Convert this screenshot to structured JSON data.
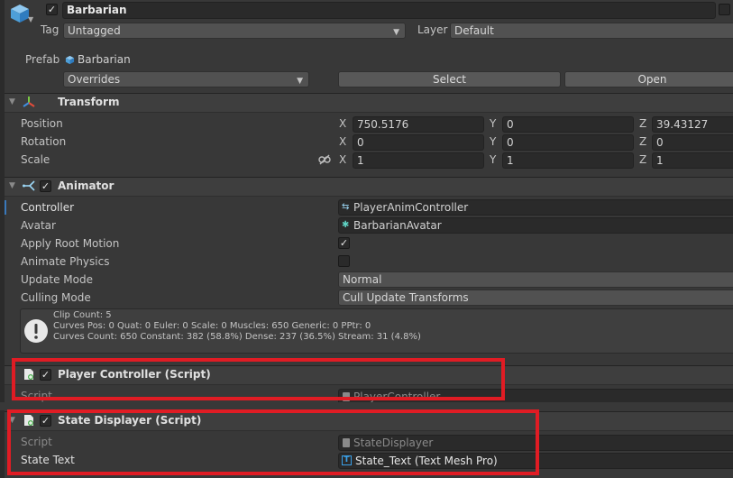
{
  "gameobject": {
    "name": "Barbarian",
    "tag_label": "Tag",
    "tag_value": "Untagged",
    "layer_label": "Layer",
    "layer_value": "Default",
    "prefab_label": "Prefab",
    "prefab_value": "Barbarian",
    "overrides_label": "Overrides",
    "select_label": "Select",
    "open_label": "Open"
  },
  "transform": {
    "title": "Transform",
    "position_label": "Position",
    "rotation_label": "Rotation",
    "scale_label": "Scale",
    "axis_x": "X",
    "axis_y": "Y",
    "axis_z": "Z",
    "position": {
      "x": "750.5176",
      "y": "0",
      "z": "39.43127"
    },
    "rotation": {
      "x": "0",
      "y": "0",
      "z": "0"
    },
    "scale": {
      "x": "1",
      "y": "1",
      "z": "1"
    }
  },
  "animator": {
    "title": "Animator",
    "controller_label": "Controller",
    "controller_value": "PlayerAnimController",
    "avatar_label": "Avatar",
    "avatar_value": "BarbarianAvatar",
    "apply_root_motion_label": "Apply Root Motion",
    "apply_root_motion": true,
    "animate_physics_label": "Animate Physics",
    "animate_physics": false,
    "update_mode_label": "Update Mode",
    "update_mode_value": "Normal",
    "culling_mode_label": "Culling Mode",
    "culling_mode_value": "Cull Update Transforms",
    "info_line1": "Clip Count: 5",
    "info_line2": "Curves Pos: 0 Quat: 0 Euler: 0 Scale: 0 Muscles: 650 Generic: 0 PPtr: 0",
    "info_line3": "Curves Count: 650 Constant: 382 (58.8%) Dense: 237 (36.5%) Stream: 31 (4.8%)"
  },
  "player_controller": {
    "title": "Player Controller (Script)",
    "script_label": "Script",
    "script_value": "PlayerController"
  },
  "state_displayer": {
    "title": "State Displayer (Script)",
    "script_label": "Script",
    "script_value": "StateDisplayer",
    "state_text_label": "State Text",
    "state_text_value": "State_Text (Text Mesh Pro)"
  },
  "colors": {
    "background": "#383838",
    "field": "#2a2a2a",
    "highlight_box": "#e01c24"
  }
}
